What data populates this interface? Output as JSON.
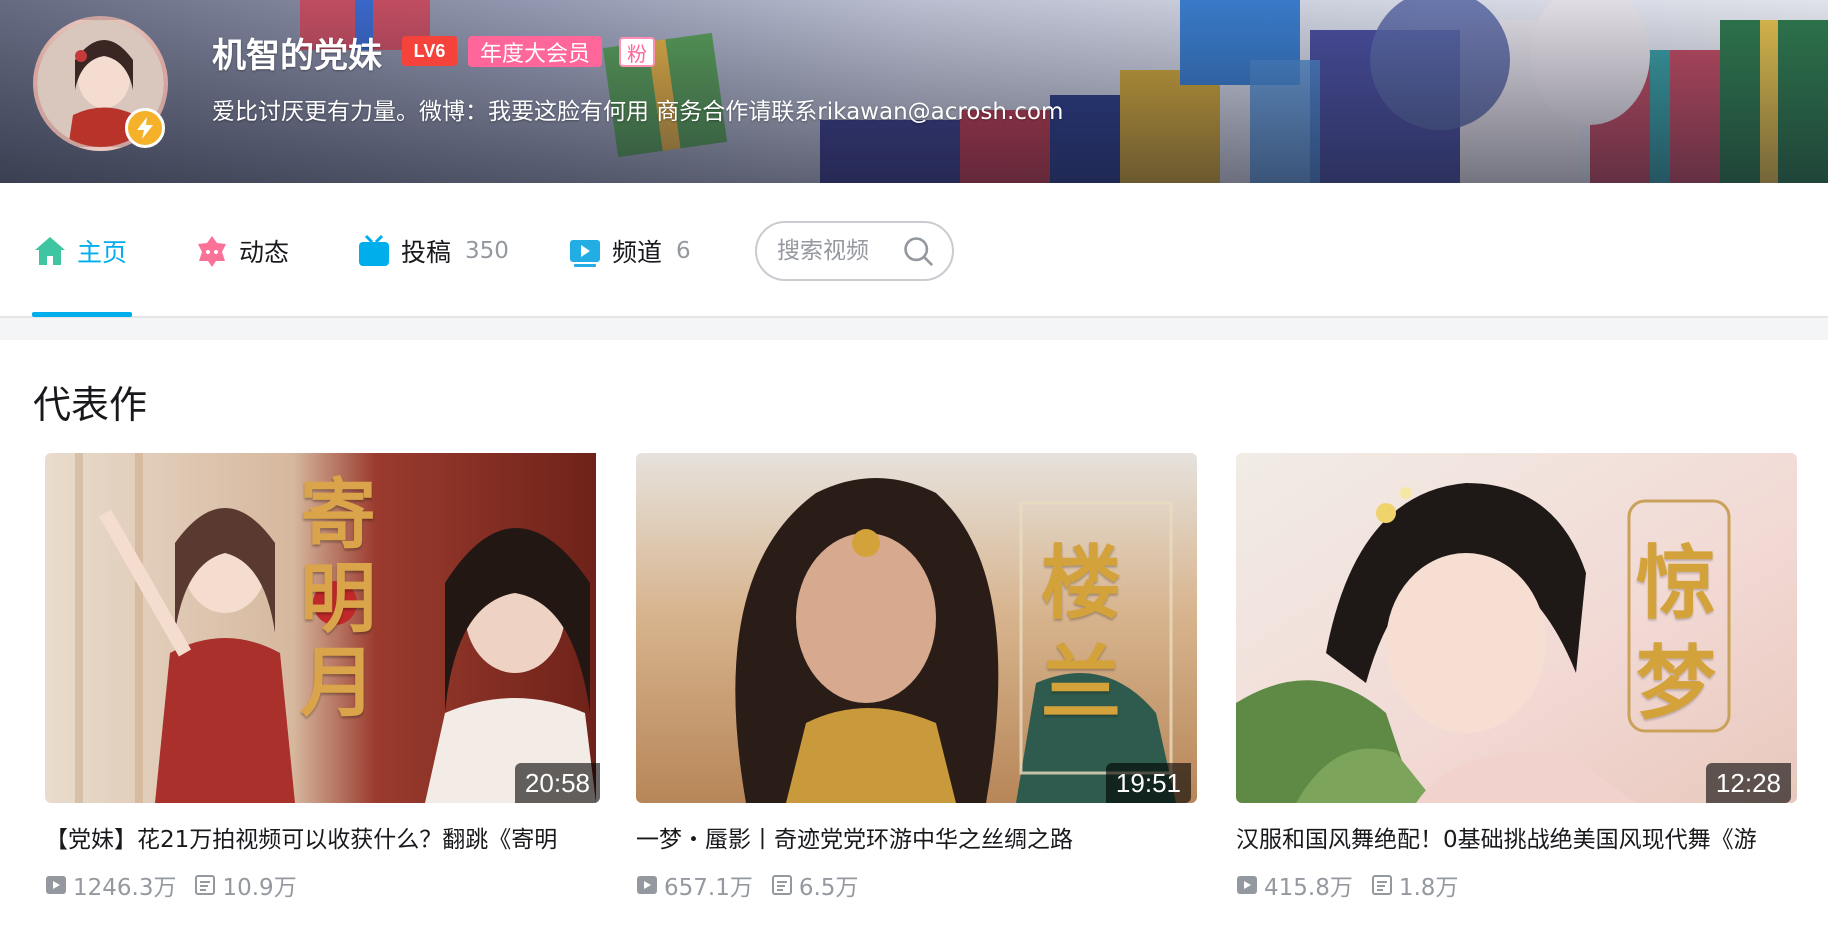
{
  "profile": {
    "username": "机智的党妹",
    "level_badge": "LV6",
    "vip_badge": "年度大会员",
    "fan_badge": "粉",
    "signature": "爱比讨厌更有力量。微博：我要这脸有何用 商务合作请联系rikawan@acrosh.com"
  },
  "nav": {
    "items": [
      {
        "label": "主页",
        "count": "",
        "icon": "home-icon",
        "active": true
      },
      {
        "label": "动态",
        "count": "",
        "icon": "dynamic-icon",
        "active": false
      },
      {
        "label": "投稿",
        "count": "350",
        "icon": "tv-icon",
        "active": false
      },
      {
        "label": "频道",
        "count": "6",
        "icon": "channel-icon",
        "active": false
      }
    ],
    "search_placeholder": "搜索视频"
  },
  "section": {
    "title": "代表作"
  },
  "videos": [
    {
      "title": "【党妹】花21万拍视频可以收获什么？翻跳《寄明",
      "duration": "20:58",
      "plays": "1246.3万",
      "danmaku": "10.9万",
      "thumb_text": "寄明月"
    },
    {
      "title": "一梦・蜃影丨奇迹党党环游中华之丝绸之路",
      "duration": "19:51",
      "plays": "657.1万",
      "danmaku": "6.5万",
      "thumb_text": "楼兰"
    },
    {
      "title": "汉服和国风舞绝配！0基础挑战绝美国风现代舞《游",
      "duration": "12:28",
      "plays": "415.8万",
      "danmaku": "1.8万",
      "thumb_text": "惊梦"
    }
  ],
  "colors": {
    "accent": "#00aeec",
    "vip": "#ff6699",
    "level": "#f5433c"
  }
}
